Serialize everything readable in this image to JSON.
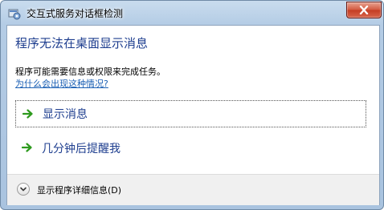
{
  "window": {
    "title": "交互式服务对话框检测",
    "icon": "interactive-services-icon",
    "close_icon": "close-icon"
  },
  "main": {
    "heading": "程序无法在桌面显示消息",
    "description": "程序可能需要信息或权限来完成任务。",
    "help_link": "为什么会出现这种情况?"
  },
  "commands": [
    {
      "label": "显示消息",
      "icon": "green-arrow-icon",
      "focused": true
    },
    {
      "label": "几分钟后提醒我",
      "icon": "green-arrow-icon",
      "focused": false
    }
  ],
  "footer": {
    "details_label": "显示程序详细信息(D)",
    "expand_icon": "chevron-down-icon"
  },
  "colors": {
    "heading": "#1e3e8f",
    "link": "#1a5fb4",
    "arrow": "#2e9a1e",
    "close_button": "#c43c22"
  }
}
